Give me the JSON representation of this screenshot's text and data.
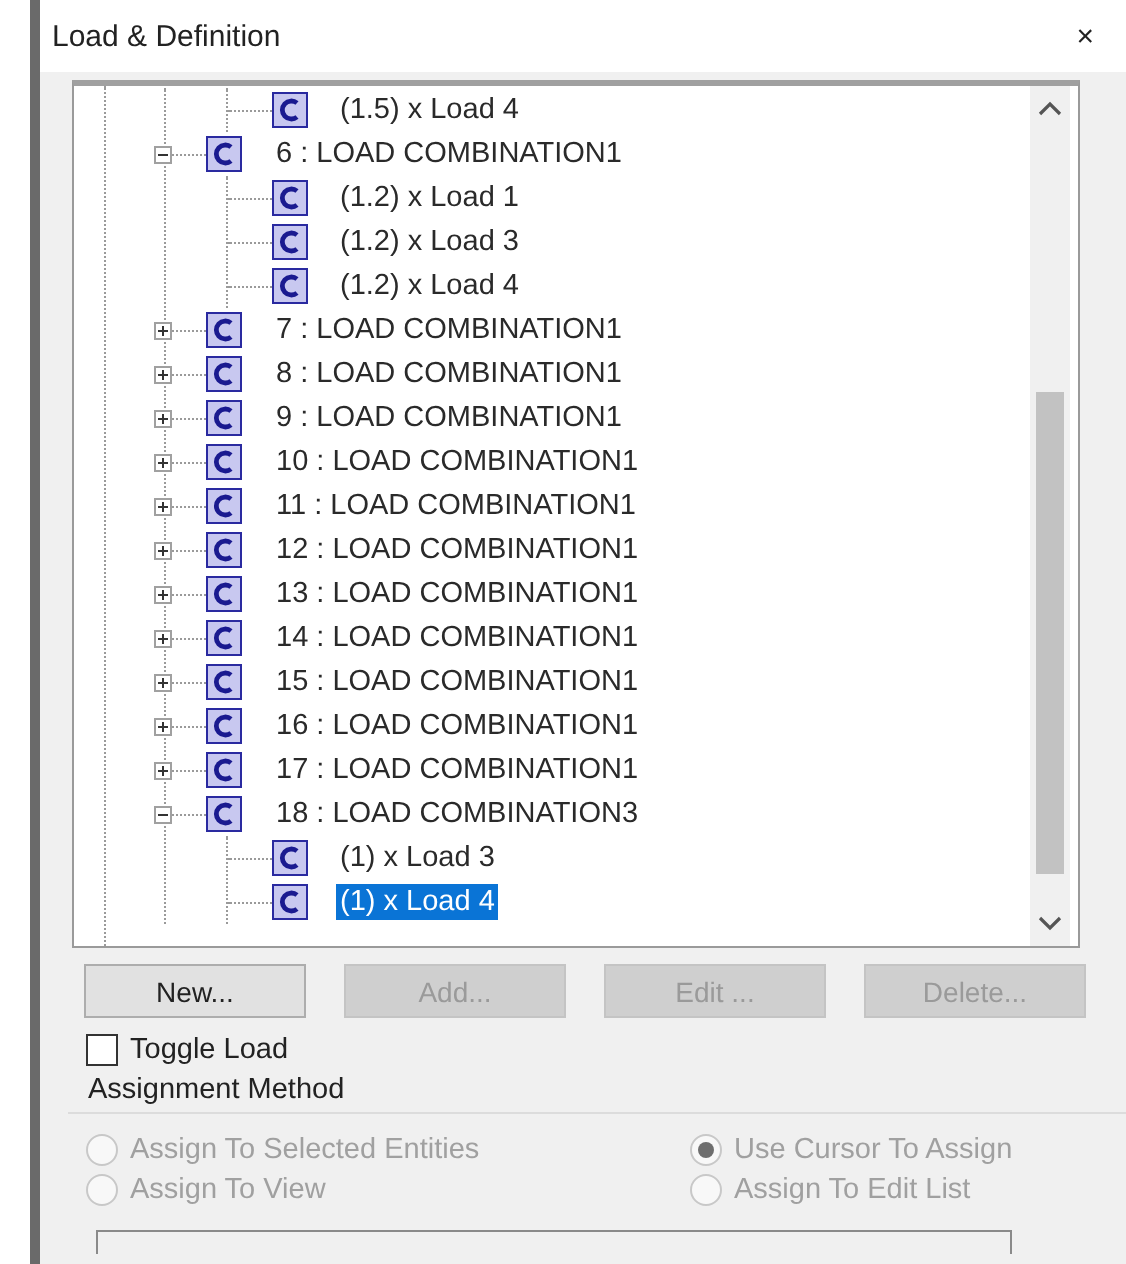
{
  "window": {
    "title": "Load & Definition",
    "close": "×"
  },
  "tree": {
    "items": [
      {
        "children": [
          {
            "label": "(1.5) x Load 4",
            "selected": false
          }
        ]
      },
      {
        "label": "6 : LOAD COMBINATION1",
        "expanded": true,
        "children": [
          {
            "label": "(1.2) x Load 1",
            "selected": false
          },
          {
            "label": "(1.2) x Load 3",
            "selected": false
          },
          {
            "label": "(1.2) x Load 4",
            "selected": false
          }
        ]
      },
      {
        "label": "7 : LOAD COMBINATION1",
        "expanded": false
      },
      {
        "label": "8 : LOAD COMBINATION1",
        "expanded": false
      },
      {
        "label": "9 : LOAD COMBINATION1",
        "expanded": false
      },
      {
        "label": "10 : LOAD COMBINATION1",
        "expanded": false
      },
      {
        "label": "11 : LOAD COMBINATION1",
        "expanded": false
      },
      {
        "label": "12 : LOAD COMBINATION1",
        "expanded": false
      },
      {
        "label": "13 : LOAD COMBINATION1",
        "expanded": false
      },
      {
        "label": "14 : LOAD COMBINATION1",
        "expanded": false
      },
      {
        "label": "15 : LOAD COMBINATION1",
        "expanded": false
      },
      {
        "label": "16 : LOAD COMBINATION1",
        "expanded": false
      },
      {
        "label": "17 : LOAD COMBINATION1",
        "expanded": false
      },
      {
        "label": "18 : LOAD COMBINATION3",
        "expanded": true,
        "children": [
          {
            "label": "(1) x Load 3",
            "selected": false
          },
          {
            "label": "(1) x Load 4",
            "selected": true
          }
        ]
      }
    ]
  },
  "buttons": [
    {
      "label": "New...",
      "disabled": false
    },
    {
      "label": "Add...",
      "disabled": true
    },
    {
      "label": "Edit ...",
      "disabled": true
    },
    {
      "label": "Delete...",
      "disabled": true
    }
  ],
  "toggle_load": {
    "label": "Toggle Load",
    "checked": false
  },
  "assignment_method": {
    "title": "Assignment Method",
    "disabled": true,
    "options": [
      {
        "label": "Assign To Selected Entities",
        "selected": false
      },
      {
        "label": "Use Cursor To Assign",
        "selected": true
      },
      {
        "label": "Assign To View",
        "selected": false
      },
      {
        "label": "Assign To Edit List",
        "selected": false
      }
    ]
  }
}
